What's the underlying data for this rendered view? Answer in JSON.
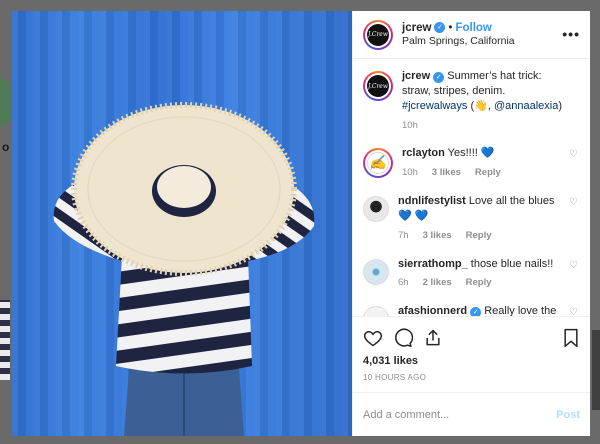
{
  "post": {
    "username": "jcrew",
    "follow_label": "Follow",
    "location": "Palm Springs, California",
    "more_label": "•••",
    "avatar_text": "J.Crew"
  },
  "caption": {
    "username": "jcrew",
    "text": "Summer’s hat trick: straw, stripes, denim.",
    "hashtag": "#jcrewalways",
    "paren_open": "(👋,",
    "mention": "@annaalexia",
    "paren_close": ")",
    "time": "10h"
  },
  "comments": [
    {
      "username": "rclayton",
      "text": "Yes!!!! 💙",
      "time": "10h",
      "likes": "3 likes",
      "reply": "Reply"
    },
    {
      "username": "ndnlifestylist",
      "text": "Love all the blues 💙 💙",
      "time": "7h",
      "likes": "3 likes",
      "reply": "Reply"
    },
    {
      "username": "sierrathomp_",
      "text": "those blue nails!!",
      "time": "6h",
      "likes": "2 likes",
      "reply": "Reply"
    },
    {
      "username": "afashionnerd",
      "text": "Really love the"
    }
  ],
  "stats": {
    "likes": "4,031 likes",
    "timestamp": "10 HOURS AGO"
  },
  "comment_box": {
    "placeholder": "Add a comment...",
    "post_label": "Post"
  },
  "colors": {
    "link": "#3897f0",
    "photo_blue": "#2f6fd0",
    "post_disabled": "#b2dffc"
  },
  "icons": [
    "heart-icon",
    "comment-icon",
    "share-icon",
    "bookmark-icon",
    "verified-badge-icon",
    "more-options-icon"
  ]
}
